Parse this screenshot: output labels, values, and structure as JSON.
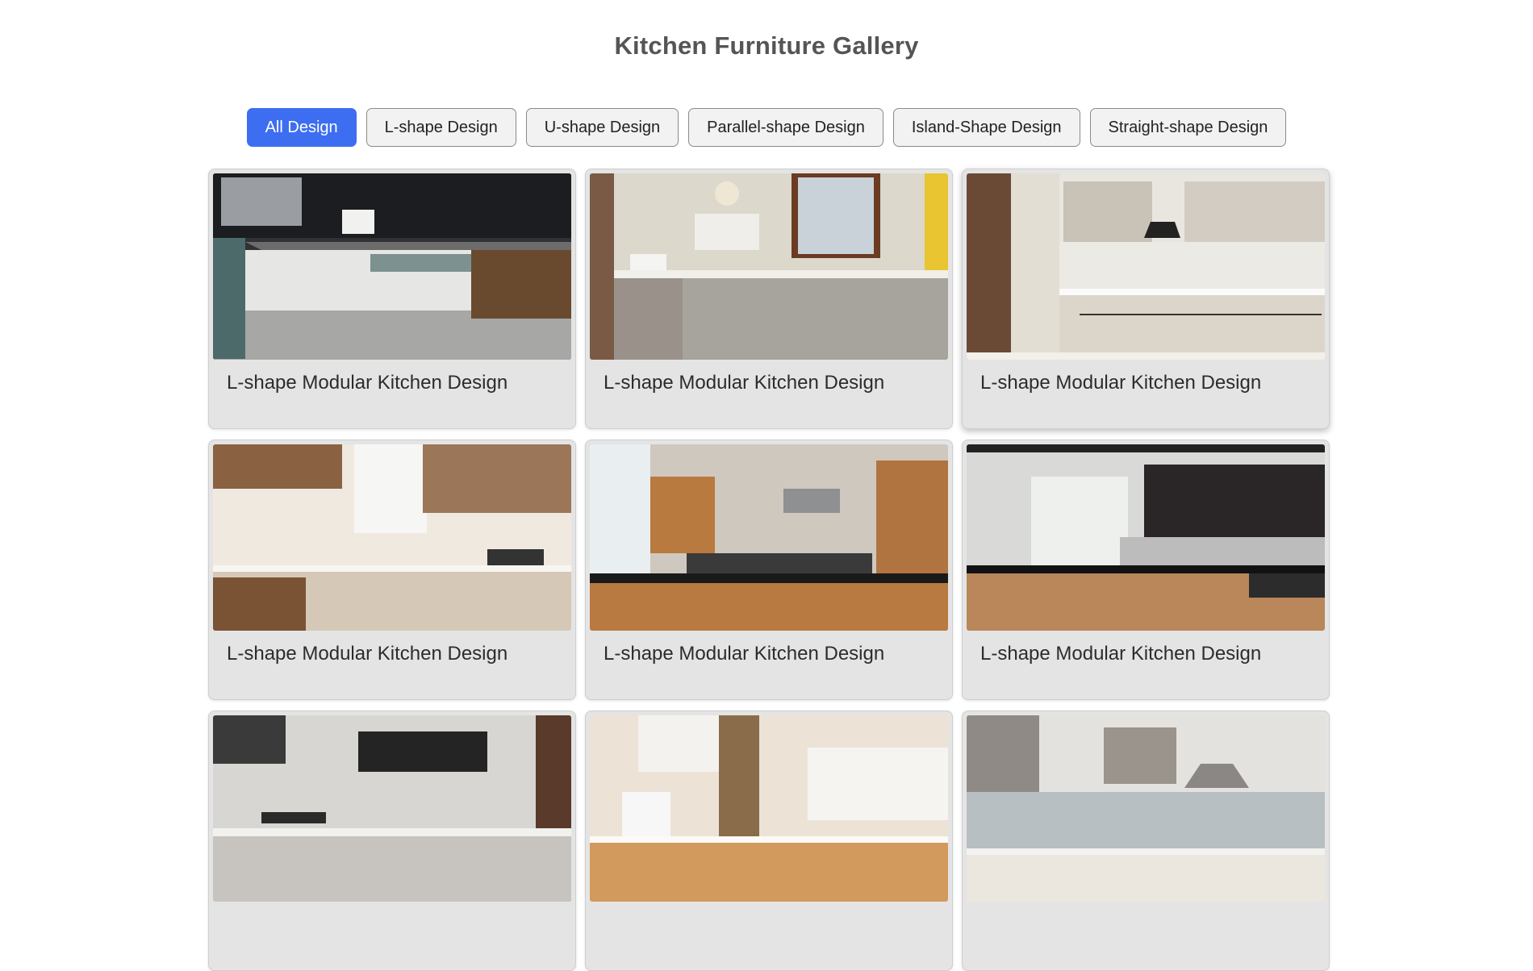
{
  "page": {
    "title": "Kitchen Furniture Gallery"
  },
  "filters": [
    {
      "label": "All Design",
      "active": true
    },
    {
      "label": "L-shape Design",
      "active": false
    },
    {
      "label": "U-shape Design",
      "active": false
    },
    {
      "label": "Parallel-shape Design",
      "active": false
    },
    {
      "label": "Island-Shape Design",
      "active": false
    },
    {
      "label": "Straight-shape Design",
      "active": false
    }
  ],
  "gallery": {
    "items": [
      {
        "title": "L-shape Modular Kitchen Design",
        "image": "l-shape-kitchen-photo-1"
      },
      {
        "title": "L-shape Modular Kitchen Design",
        "image": "l-shape-kitchen-photo-2"
      },
      {
        "title": "L-shape Modular Kitchen Design",
        "image": "l-shape-kitchen-photo-3"
      },
      {
        "title": "L-shape Modular Kitchen Design",
        "image": "l-shape-kitchen-photo-4"
      },
      {
        "title": "L-shape Modular Kitchen Design",
        "image": "l-shape-kitchen-photo-5"
      },
      {
        "title": "L-shape Modular Kitchen Design",
        "image": "l-shape-kitchen-photo-6"
      },
      {
        "title": "",
        "image": "kitchen-photo-7"
      },
      {
        "title": "",
        "image": "kitchen-photo-8"
      },
      {
        "title": "",
        "image": "kitchen-photo-9"
      }
    ]
  },
  "colors": {
    "accent": "#3d6ef2",
    "card_background": "#e4e4e4",
    "title_text": "#555555"
  }
}
